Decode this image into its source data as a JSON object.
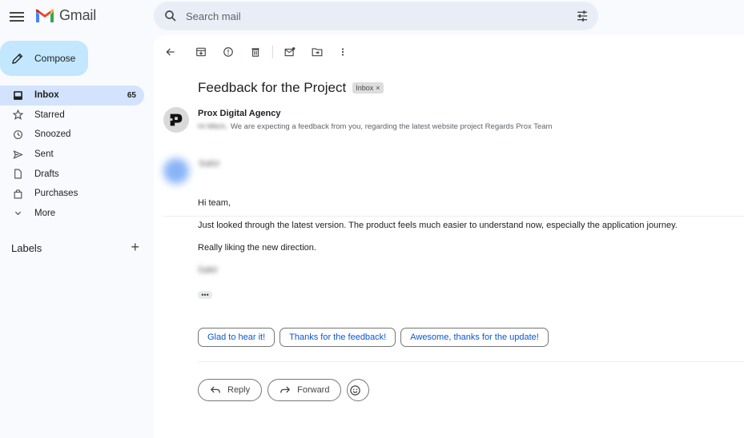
{
  "app": {
    "name": "Gmail"
  },
  "search": {
    "placeholder": "Search mail"
  },
  "compose": {
    "label": "Compose"
  },
  "nav": {
    "items": [
      {
        "label": "Inbox",
        "count": "65",
        "icon": "inbox-icon"
      },
      {
        "label": "Starred",
        "icon": "star-icon"
      },
      {
        "label": "Snoozed",
        "icon": "clock-icon"
      },
      {
        "label": "Sent",
        "icon": "send-icon"
      },
      {
        "label": "Drafts",
        "icon": "draft-icon"
      },
      {
        "label": "Purchases",
        "icon": "shopping-bag-icon"
      },
      {
        "label": "More",
        "icon": "chevron-down-icon"
      }
    ]
  },
  "labels": {
    "title": "Labels"
  },
  "email": {
    "subject": "Feedback for the Project",
    "label_chip": "Inbox",
    "sender": "Prox Digital Agency",
    "snippet_prefix": "Hi Mitch,",
    "snippet": "We are expecting a feedback from you, regarding the latest website project Regards Prox Team",
    "reply_sender": "Sakir",
    "body": {
      "greeting": "Hi team,",
      "line1": "Just looked through the latest version. The product feels much easier to understand now, especially the application journey.",
      "line2": "Really liking the new direction.",
      "signature": "Sakir"
    }
  },
  "smart_replies": [
    "Glad to hear it!",
    "Thanks for the feedback!",
    "Awesome, thanks for the update!"
  ],
  "actions": {
    "reply": "Reply",
    "forward": "Forward"
  },
  "colors": {
    "accent": "#0b57d0",
    "compose_bg": "#c2e7ff",
    "active_nav": "#d3e3fd",
    "search_bg": "#e9eef6"
  }
}
